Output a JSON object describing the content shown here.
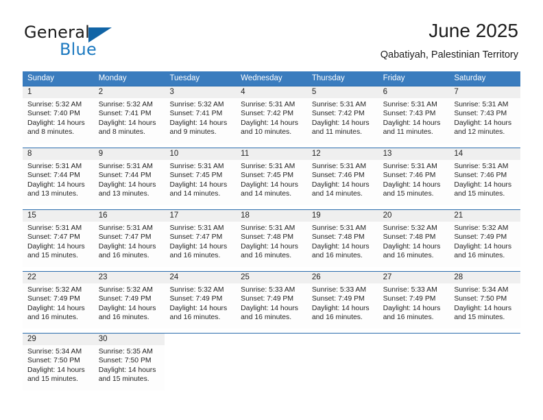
{
  "brand": {
    "name_part1": "General",
    "name_part2": "Blue",
    "triangle_icon": "triangle-icon",
    "accent_color": "#1164a6"
  },
  "header": {
    "title": "June 2025",
    "subtitle": "Qabatiyah, Palestinian Territory"
  },
  "calendar": {
    "header_bg": "#3a7cbe",
    "row_border": "#2a6cad",
    "daynum_bg": "#efefef",
    "weekdays": [
      "Sunday",
      "Monday",
      "Tuesday",
      "Wednesday",
      "Thursday",
      "Friday",
      "Saturday"
    ],
    "weeks": [
      [
        {
          "day": "1",
          "sunrise": "Sunrise: 5:32 AM",
          "sunset": "Sunset: 7:40 PM",
          "daylight_line1": "Daylight: 14 hours",
          "daylight_line2": "and 8 minutes."
        },
        {
          "day": "2",
          "sunrise": "Sunrise: 5:32 AM",
          "sunset": "Sunset: 7:41 PM",
          "daylight_line1": "Daylight: 14 hours",
          "daylight_line2": "and 8 minutes."
        },
        {
          "day": "3",
          "sunrise": "Sunrise: 5:32 AM",
          "sunset": "Sunset: 7:41 PM",
          "daylight_line1": "Daylight: 14 hours",
          "daylight_line2": "and 9 minutes."
        },
        {
          "day": "4",
          "sunrise": "Sunrise: 5:31 AM",
          "sunset": "Sunset: 7:42 PM",
          "daylight_line1": "Daylight: 14 hours",
          "daylight_line2": "and 10 minutes."
        },
        {
          "day": "5",
          "sunrise": "Sunrise: 5:31 AM",
          "sunset": "Sunset: 7:42 PM",
          "daylight_line1": "Daylight: 14 hours",
          "daylight_line2": "and 11 minutes."
        },
        {
          "day": "6",
          "sunrise": "Sunrise: 5:31 AM",
          "sunset": "Sunset: 7:43 PM",
          "daylight_line1": "Daylight: 14 hours",
          "daylight_line2": "and 11 minutes."
        },
        {
          "day": "7",
          "sunrise": "Sunrise: 5:31 AM",
          "sunset": "Sunset: 7:43 PM",
          "daylight_line1": "Daylight: 14 hours",
          "daylight_line2": "and 12 minutes."
        }
      ],
      [
        {
          "day": "8",
          "sunrise": "Sunrise: 5:31 AM",
          "sunset": "Sunset: 7:44 PM",
          "daylight_line1": "Daylight: 14 hours",
          "daylight_line2": "and 13 minutes."
        },
        {
          "day": "9",
          "sunrise": "Sunrise: 5:31 AM",
          "sunset": "Sunset: 7:44 PM",
          "daylight_line1": "Daylight: 14 hours",
          "daylight_line2": "and 13 minutes."
        },
        {
          "day": "10",
          "sunrise": "Sunrise: 5:31 AM",
          "sunset": "Sunset: 7:45 PM",
          "daylight_line1": "Daylight: 14 hours",
          "daylight_line2": "and 14 minutes."
        },
        {
          "day": "11",
          "sunrise": "Sunrise: 5:31 AM",
          "sunset": "Sunset: 7:45 PM",
          "daylight_line1": "Daylight: 14 hours",
          "daylight_line2": "and 14 minutes."
        },
        {
          "day": "12",
          "sunrise": "Sunrise: 5:31 AM",
          "sunset": "Sunset: 7:46 PM",
          "daylight_line1": "Daylight: 14 hours",
          "daylight_line2": "and 14 minutes."
        },
        {
          "day": "13",
          "sunrise": "Sunrise: 5:31 AM",
          "sunset": "Sunset: 7:46 PM",
          "daylight_line1": "Daylight: 14 hours",
          "daylight_line2": "and 15 minutes."
        },
        {
          "day": "14",
          "sunrise": "Sunrise: 5:31 AM",
          "sunset": "Sunset: 7:46 PM",
          "daylight_line1": "Daylight: 14 hours",
          "daylight_line2": "and 15 minutes."
        }
      ],
      [
        {
          "day": "15",
          "sunrise": "Sunrise: 5:31 AM",
          "sunset": "Sunset: 7:47 PM",
          "daylight_line1": "Daylight: 14 hours",
          "daylight_line2": "and 15 minutes."
        },
        {
          "day": "16",
          "sunrise": "Sunrise: 5:31 AM",
          "sunset": "Sunset: 7:47 PM",
          "daylight_line1": "Daylight: 14 hours",
          "daylight_line2": "and 16 minutes."
        },
        {
          "day": "17",
          "sunrise": "Sunrise: 5:31 AM",
          "sunset": "Sunset: 7:47 PM",
          "daylight_line1": "Daylight: 14 hours",
          "daylight_line2": "and 16 minutes."
        },
        {
          "day": "18",
          "sunrise": "Sunrise: 5:31 AM",
          "sunset": "Sunset: 7:48 PM",
          "daylight_line1": "Daylight: 14 hours",
          "daylight_line2": "and 16 minutes."
        },
        {
          "day": "19",
          "sunrise": "Sunrise: 5:31 AM",
          "sunset": "Sunset: 7:48 PM",
          "daylight_line1": "Daylight: 14 hours",
          "daylight_line2": "and 16 minutes."
        },
        {
          "day": "20",
          "sunrise": "Sunrise: 5:32 AM",
          "sunset": "Sunset: 7:48 PM",
          "daylight_line1": "Daylight: 14 hours",
          "daylight_line2": "and 16 minutes."
        },
        {
          "day": "21",
          "sunrise": "Sunrise: 5:32 AM",
          "sunset": "Sunset: 7:49 PM",
          "daylight_line1": "Daylight: 14 hours",
          "daylight_line2": "and 16 minutes."
        }
      ],
      [
        {
          "day": "22",
          "sunrise": "Sunrise: 5:32 AM",
          "sunset": "Sunset: 7:49 PM",
          "daylight_line1": "Daylight: 14 hours",
          "daylight_line2": "and 16 minutes."
        },
        {
          "day": "23",
          "sunrise": "Sunrise: 5:32 AM",
          "sunset": "Sunset: 7:49 PM",
          "daylight_line1": "Daylight: 14 hours",
          "daylight_line2": "and 16 minutes."
        },
        {
          "day": "24",
          "sunrise": "Sunrise: 5:32 AM",
          "sunset": "Sunset: 7:49 PM",
          "daylight_line1": "Daylight: 14 hours",
          "daylight_line2": "and 16 minutes."
        },
        {
          "day": "25",
          "sunrise": "Sunrise: 5:33 AM",
          "sunset": "Sunset: 7:49 PM",
          "daylight_line1": "Daylight: 14 hours",
          "daylight_line2": "and 16 minutes."
        },
        {
          "day": "26",
          "sunrise": "Sunrise: 5:33 AM",
          "sunset": "Sunset: 7:49 PM",
          "daylight_line1": "Daylight: 14 hours",
          "daylight_line2": "and 16 minutes."
        },
        {
          "day": "27",
          "sunrise": "Sunrise: 5:33 AM",
          "sunset": "Sunset: 7:49 PM",
          "daylight_line1": "Daylight: 14 hours",
          "daylight_line2": "and 16 minutes."
        },
        {
          "day": "28",
          "sunrise": "Sunrise: 5:34 AM",
          "sunset": "Sunset: 7:50 PM",
          "daylight_line1": "Daylight: 14 hours",
          "daylight_line2": "and 15 minutes."
        }
      ],
      [
        {
          "day": "29",
          "sunrise": "Sunrise: 5:34 AM",
          "sunset": "Sunset: 7:50 PM",
          "daylight_line1": "Daylight: 14 hours",
          "daylight_line2": "and 15 minutes."
        },
        {
          "day": "30",
          "sunrise": "Sunrise: 5:35 AM",
          "sunset": "Sunset: 7:50 PM",
          "daylight_line1": "Daylight: 14 hours",
          "daylight_line2": "and 15 minutes."
        },
        {
          "day": "",
          "sunrise": "",
          "sunset": "",
          "daylight_line1": "",
          "daylight_line2": ""
        },
        {
          "day": "",
          "sunrise": "",
          "sunset": "",
          "daylight_line1": "",
          "daylight_line2": ""
        },
        {
          "day": "",
          "sunrise": "",
          "sunset": "",
          "daylight_line1": "",
          "daylight_line2": ""
        },
        {
          "day": "",
          "sunrise": "",
          "sunset": "",
          "daylight_line1": "",
          "daylight_line2": ""
        },
        {
          "day": "",
          "sunrise": "",
          "sunset": "",
          "daylight_line1": "",
          "daylight_line2": ""
        }
      ]
    ]
  }
}
